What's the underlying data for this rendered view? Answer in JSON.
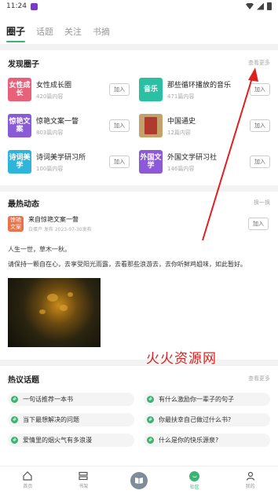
{
  "status_bar": {
    "time": "11:24"
  },
  "top_tabs": [
    {
      "label": "圈子",
      "active": true
    },
    {
      "label": "话题",
      "active": false
    },
    {
      "label": "关注",
      "active": false
    },
    {
      "label": "书摘",
      "active": false
    }
  ],
  "discover": {
    "title": "发现圈子",
    "more": "查看更多",
    "join_label": "加入",
    "items": [
      {
        "cover_text": "女性成长",
        "cover_color": "#e8607a",
        "name": "女性成长圈",
        "count": "420篇内容"
      },
      {
        "cover_text": "音乐",
        "cover_color": "#2bbfa4",
        "name": "那些循环播放的音乐",
        "count": "471篇内容"
      },
      {
        "cover_text": "惊艳文案",
        "cover_color": "#8a5bd6",
        "name": "惊艳文案一瞥",
        "count": "803篇内容"
      },
      {
        "cover_text": "",
        "cover_color": "#c4a06a",
        "name": "中国通史",
        "count": "12篇内容"
      },
      {
        "cover_text": "诗词美学",
        "cover_color": "#2fb5d9",
        "name": "诗词美学研习所",
        "count": "100篇内容"
      },
      {
        "cover_text": "外国文学",
        "cover_color": "#8c5ad8",
        "name": "外国文学研习社",
        "count": "146篇内容"
      }
    ]
  },
  "hot": {
    "title": "最热动态",
    "more": "换一换",
    "post": {
      "avatar_text": "惊艳文案",
      "author": "来自惊艳文案一瞥",
      "date": "白蛋产 发布 2023-07-30发布",
      "join_label": "加入",
      "lines": [
        "人生一世，草木一秋。",
        "请保持一颗自在心，去享受阳光雨露，去看那些浪游去，去你听鲜鸡姐味，如此暂好。"
      ]
    }
  },
  "watermark": "火火资源网",
  "topics": {
    "title": "热议话题",
    "more": "查看更多",
    "items": [
      "一句话推荐一本书",
      "有什么激励你一辈子的句子",
      "当下最想解决的问题",
      "你最扶幸自己做过什么书?",
      "爱情里的烟火气有多浪漫",
      "什么是你的快乐源泉?"
    ]
  },
  "bottom_nav": [
    {
      "label": "首页",
      "icon": "home-icon",
      "active": false
    },
    {
      "label": "书架",
      "icon": "bookshelf-icon",
      "active": false
    },
    {
      "label": "",
      "icon": "book-center-icon",
      "active": false
    },
    {
      "label": "社区",
      "icon": "community-icon",
      "active": true
    },
    {
      "label": "我的",
      "icon": "profile-icon",
      "active": false
    }
  ],
  "colors": {
    "accent": "#3cb371",
    "annotation": "#e02020"
  }
}
